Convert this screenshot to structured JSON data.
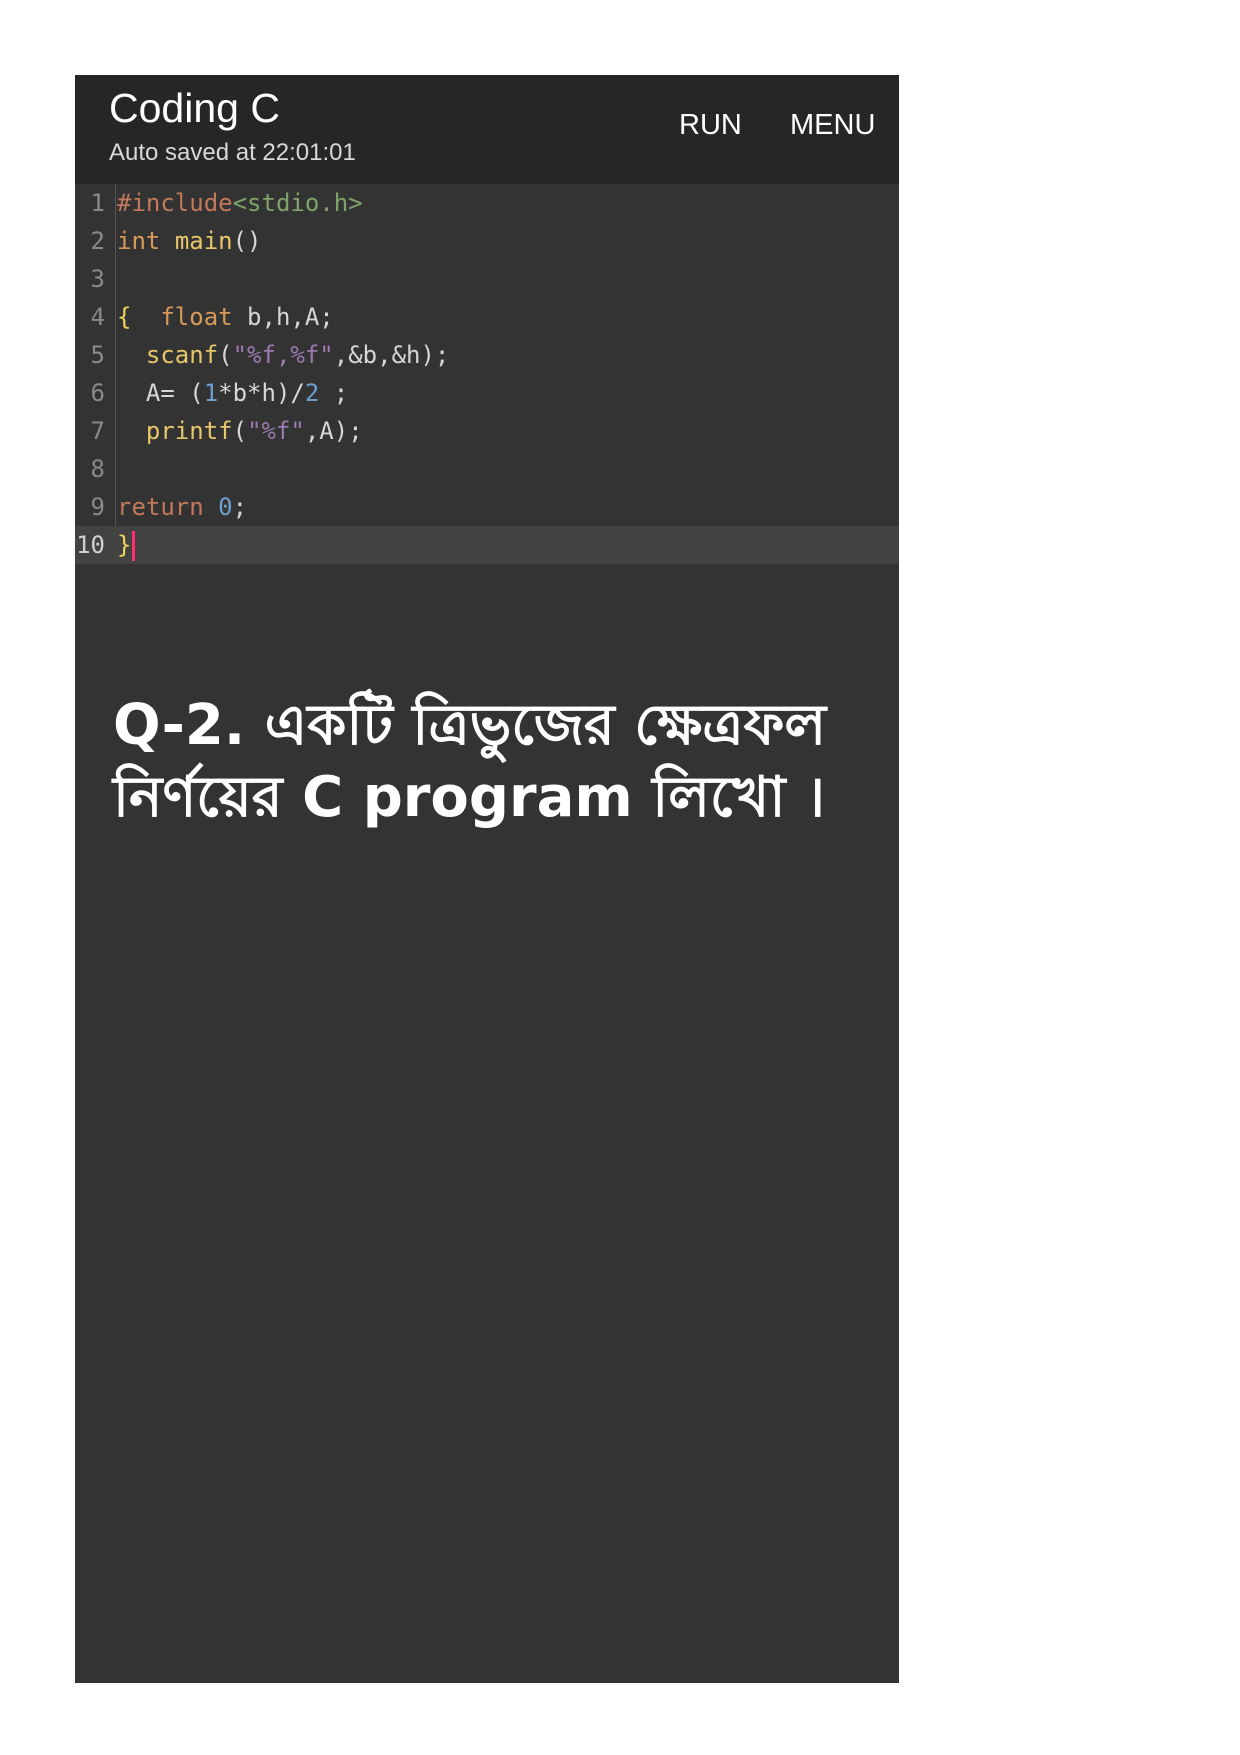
{
  "appbar": {
    "title": "Coding C",
    "subtitle": "Auto saved at 22:01:01",
    "run_label": "RUN",
    "menu_label": "MENU"
  },
  "editor": {
    "line_numbers": [
      "1",
      "2",
      "3",
      "4",
      "5",
      "6",
      "7",
      "8",
      "9",
      "10"
    ],
    "active_line": 10,
    "lines": [
      [
        {
          "t": "#include",
          "c": "pp"
        },
        {
          "t": "<stdio.h>",
          "c": "hdr"
        }
      ],
      [
        {
          "t": "int",
          "c": "kw"
        },
        {
          "t": " "
        },
        {
          "t": "main",
          "c": "fn"
        },
        {
          "t": "()"
        }
      ],
      [],
      [
        {
          "t": "{",
          "c": "br"
        },
        {
          "t": "  "
        },
        {
          "t": "float",
          "c": "kw"
        },
        {
          "t": " b,h,A;"
        }
      ],
      [
        {
          "t": "  "
        },
        {
          "t": "scanf",
          "c": "fn"
        },
        {
          "t": "("
        },
        {
          "t": "\"%f,%f\"",
          "c": "str"
        },
        {
          "t": ",&b,&h);"
        }
      ],
      [
        {
          "t": "  A= ("
        },
        {
          "t": "1",
          "c": "num"
        },
        {
          "t": "*b*h)/"
        },
        {
          "t": "2",
          "c": "num"
        },
        {
          "t": " ;"
        }
      ],
      [
        {
          "t": "  "
        },
        {
          "t": "printf",
          "c": "fn"
        },
        {
          "t": "("
        },
        {
          "t": "\"%f\"",
          "c": "str"
        },
        {
          "t": ",A);"
        }
      ],
      [],
      [
        {
          "t": "return",
          "c": "pp"
        },
        {
          "t": " "
        },
        {
          "t": "0",
          "c": "num"
        },
        {
          "t": ";"
        }
      ],
      [
        {
          "t": "}",
          "c": "br"
        }
      ]
    ]
  },
  "question": {
    "line1": "Q-2. একটি ত্রিভুজের ক্ষেত্রফল",
    "line2": "নির্ণয়ের C program লিখো ।"
  },
  "colors": {
    "appbar_bg": "#262626",
    "editor_bg": "#333333",
    "caret": "#ff2f6d"
  }
}
